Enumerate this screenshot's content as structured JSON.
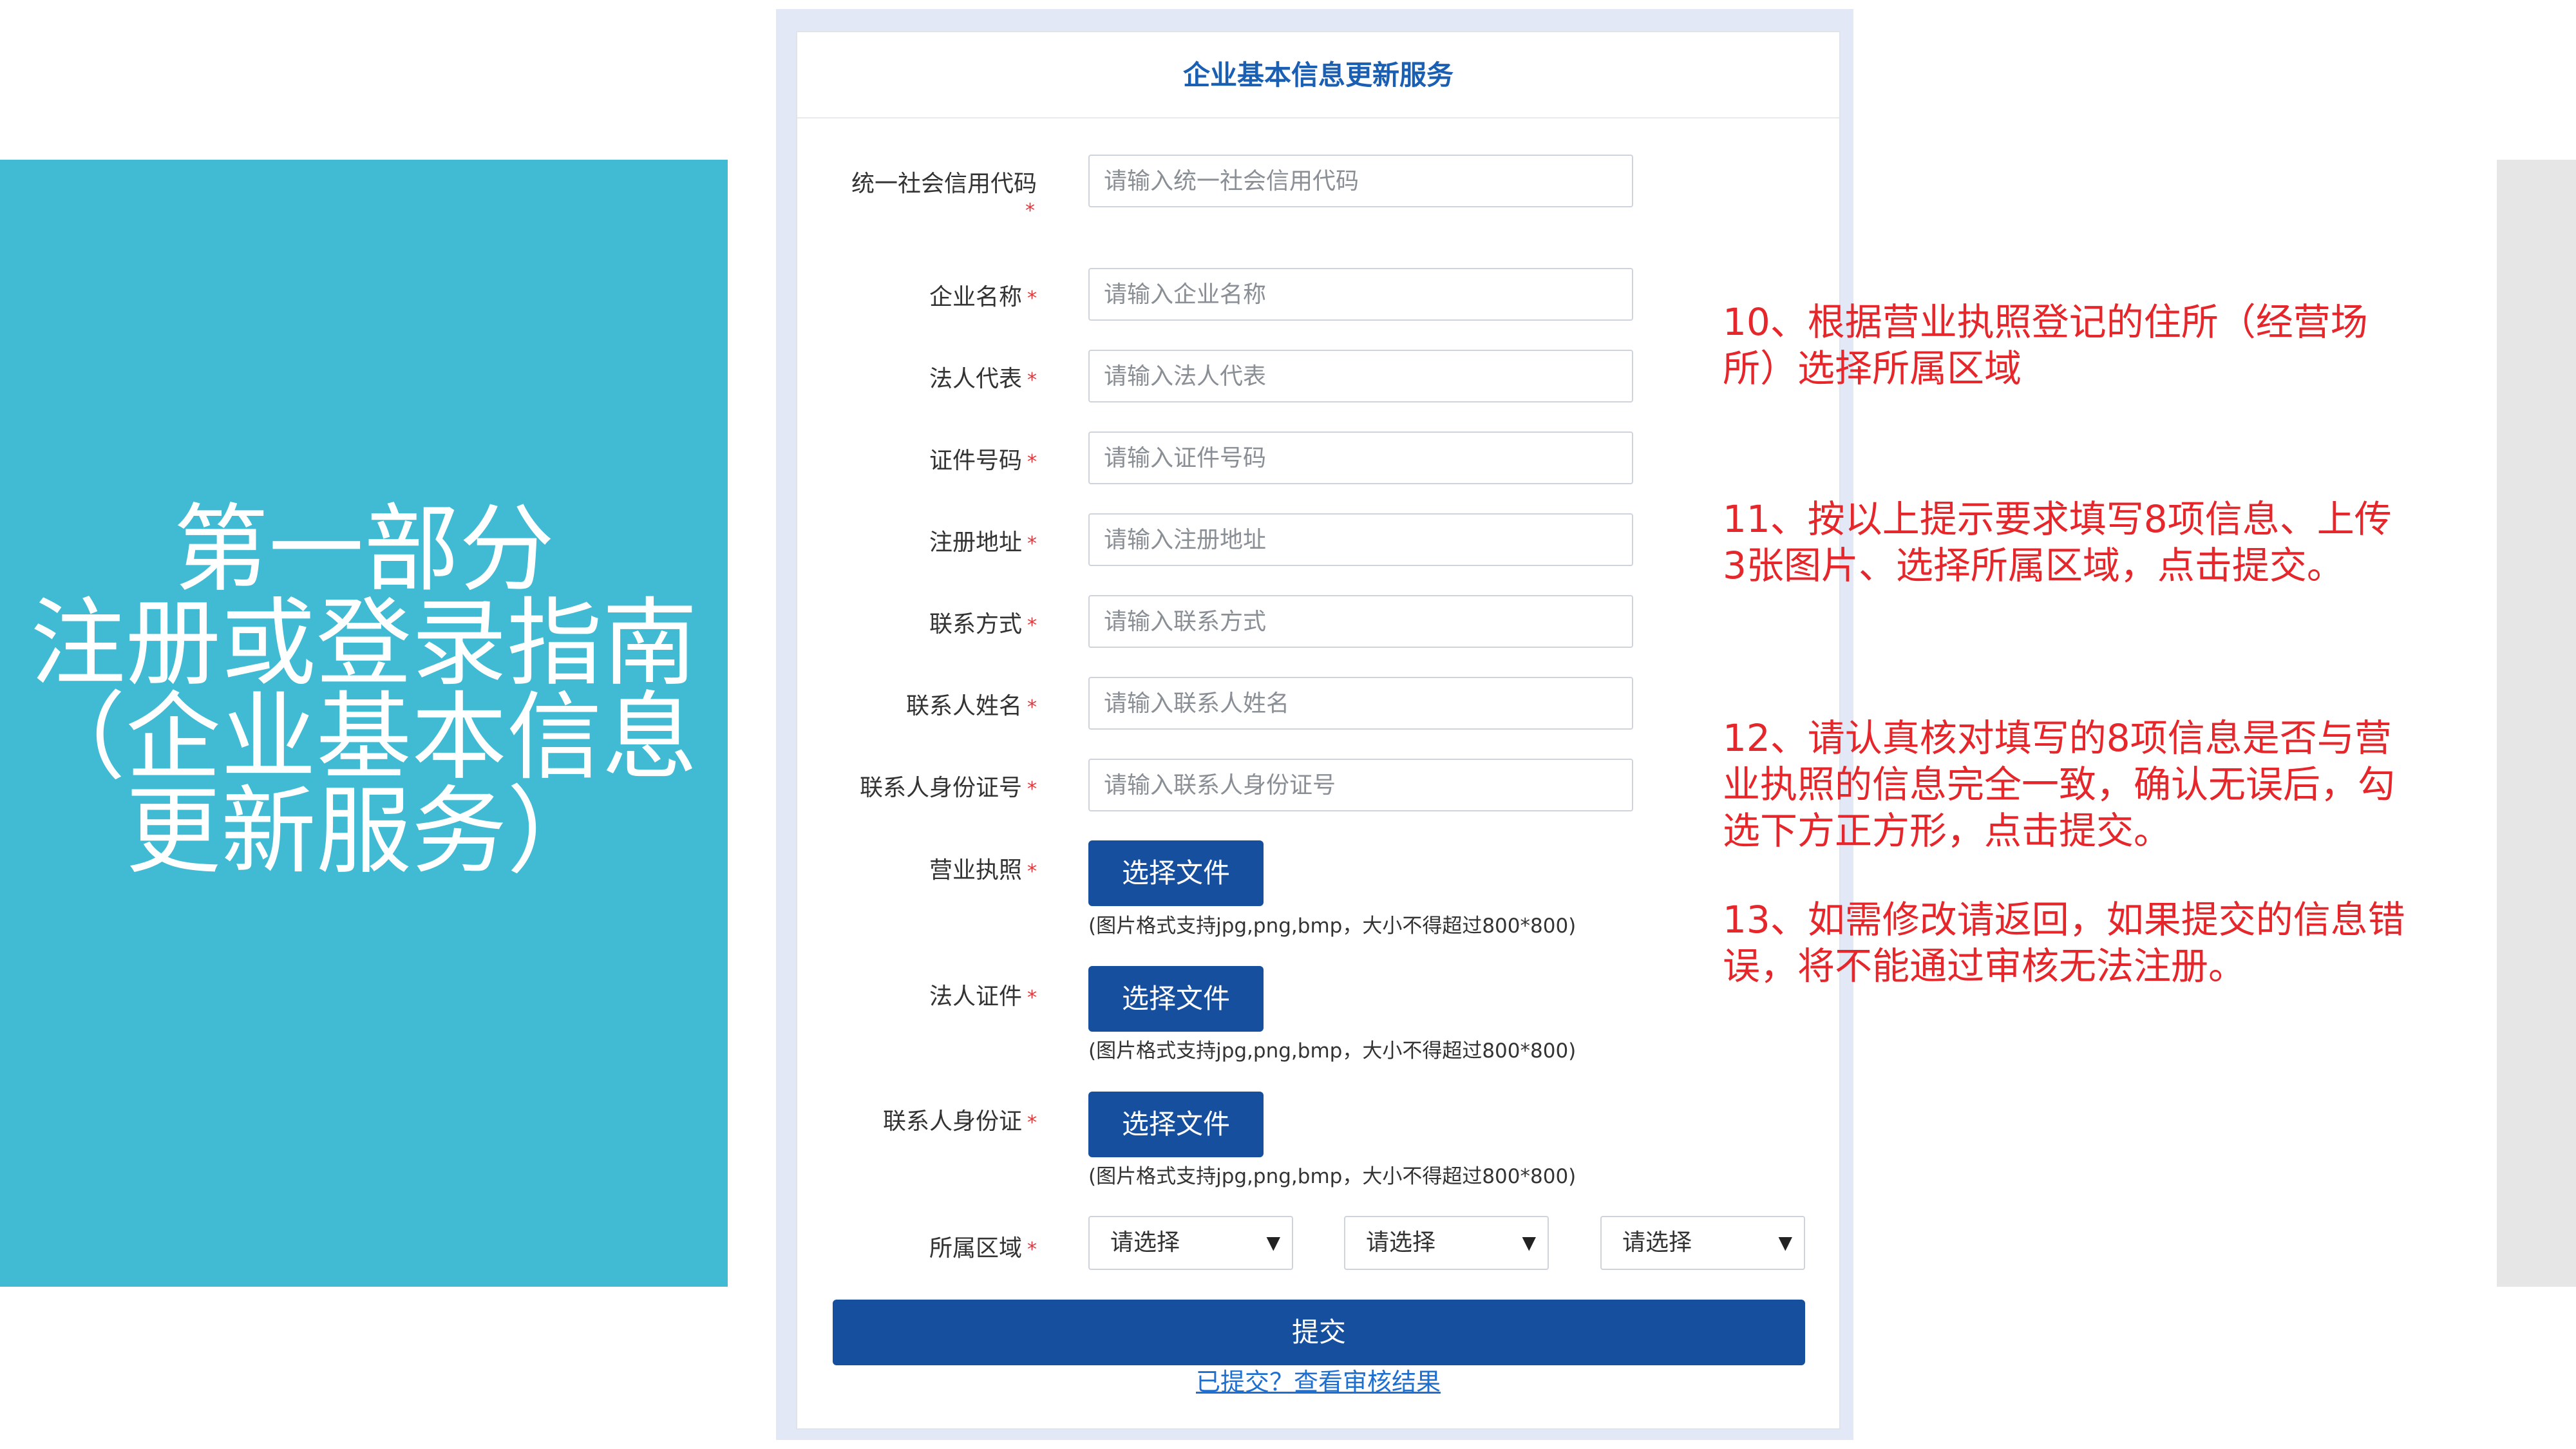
{
  "left_panel": {
    "title_lines": [
      "第一部分",
      "注册或登录指南",
      "（企业基本信息",
      "更新服务）"
    ]
  },
  "form": {
    "header": "企业基本信息更新服务",
    "required_mark": "*",
    "fields": [
      {
        "label": "统一社会信用代码",
        "placeholder": "请输入统一社会信用代码"
      },
      {
        "label": "企业名称",
        "placeholder": "请输入企业名称"
      },
      {
        "label": "法人代表",
        "placeholder": "请输入法人代表"
      },
      {
        "label": "证件号码",
        "placeholder": "请输入证件号码"
      },
      {
        "label": "注册地址",
        "placeholder": "请输入注册地址"
      },
      {
        "label": "联系方式",
        "placeholder": "请输入联系方式"
      },
      {
        "label": "联系人姓名",
        "placeholder": "请输入联系人姓名"
      },
      {
        "label": "联系人身份证号",
        "placeholder": "请输入联系人身份证号"
      }
    ],
    "uploads": [
      {
        "label": "营业执照",
        "button": "选择文件",
        "hint": "(图片格式支持jpg,png,bmp，大小不得超过800*800)"
      },
      {
        "label": "法人证件",
        "button": "选择文件",
        "hint": "(图片格式支持jpg,png,bmp，大小不得超过800*800)"
      },
      {
        "label": "联系人身份证",
        "button": "选择文件",
        "hint": "(图片格式支持jpg,png,bmp，大小不得超过800*800)"
      }
    ],
    "region": {
      "label": "所属区域",
      "selects": [
        "请选择",
        "请选择",
        "请选择"
      ],
      "caret_icon": "▼"
    },
    "submit_label": "提交",
    "check_link": "已提交？查看审核结果"
  },
  "notes": [
    "10、根据营业执照登记的住所（经营场所）选择所属区域",
    "11、按以上提示要求填写8项信息、上传3张图片、选择所属区域，点击提交。",
    "12、请认真核对填写的8项信息是否与营业执照的信息完全一致，确认无误后，勾选下方正方形，点击提交。",
    "13、如需修改请返回，如果提交的信息错误，将不能通过审核无法注册。"
  ],
  "colors": {
    "teal_panel": "#40bbd3",
    "primary_button": "#164f9e",
    "header_text": "#1b5fb3",
    "note_red": "#e5262b",
    "required_red": "#e0393e",
    "link_blue": "#1f6fd1"
  }
}
